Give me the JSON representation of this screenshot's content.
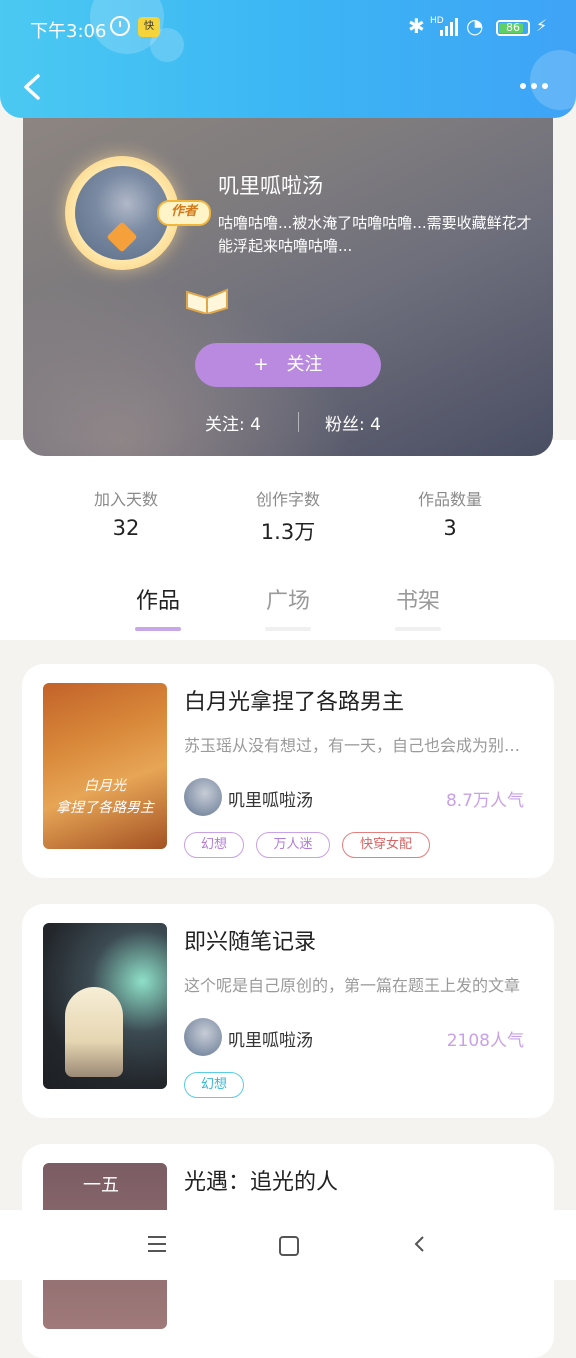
{
  "status_bar": {
    "time": "下午3:06",
    "app_badge": "快",
    "network": "HD",
    "battery": "86"
  },
  "profile": {
    "author_tag": "作者",
    "username": "叽里呱啦汤",
    "bio": "咕噜咕噜...被水淹了咕噜咕噜...需要收藏鲜花才能浮起来咕噜咕噜...",
    "follow_button": "关注",
    "following_label": "关注: 4",
    "fans_label": "粉丝: 4"
  },
  "stats": [
    {
      "label": "加入天数",
      "value": "32"
    },
    {
      "label": "创作字数",
      "value": "1.3万"
    },
    {
      "label": "作品数量",
      "value": "3"
    }
  ],
  "tabs": [
    {
      "label": "作品",
      "active": true
    },
    {
      "label": "广场",
      "active": false
    },
    {
      "label": "书架",
      "active": false
    }
  ],
  "books": [
    {
      "title": "白月光拿捏了各路男主",
      "description": "苏玉瑶从没有想过，有一天，自己也会成为别人的白月光",
      "author": "叽里呱啦汤",
      "popularity": "8.7万人气",
      "cover_text_line1": "白月光",
      "cover_text_line2": "拿捏了各路男主",
      "tags": [
        "幻想",
        "万人迷",
        "快穿女配"
      ]
    },
    {
      "title": "即兴随笔记录",
      "description": "这个呢是自己原创的，第一篇在题王上发的文章",
      "author": "叽里呱啦汤",
      "popularity": "2108人气",
      "tags": [
        "幻想"
      ]
    },
    {
      "title": "光遇：追光的人",
      "cover_text_line1": "一五"
    }
  ]
}
